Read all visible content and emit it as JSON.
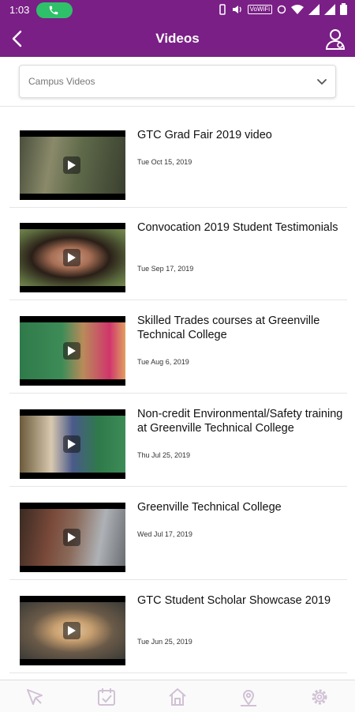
{
  "status": {
    "time": "1:03",
    "vowifi": "VoWiFi"
  },
  "header": {
    "title": "Videos"
  },
  "filter": {
    "selected": "Campus Videos"
  },
  "videos": [
    {
      "title": "GTC Grad Fair 2019 video",
      "date": "Tue Oct 15, 2019"
    },
    {
      "title": "Convocation 2019 Student Testimonials",
      "date": "Tue Sep 17, 2019"
    },
    {
      "title": "Skilled Trades courses at Greenville Technical College",
      "date": "Tue Aug 6, 2019"
    },
    {
      "title": "Non-credit Environmental/Safety training at Greenville Technical College",
      "date": "Thu Jul 25, 2019"
    },
    {
      "title": "Greenville Technical College",
      "date": "Wed Jul 17, 2019"
    },
    {
      "title": "GTC Student Scholar Showcase 2019",
      "date": "Tue Jun 25, 2019"
    }
  ],
  "bottom_nav": [
    "cursor-icon",
    "calendar-check-icon",
    "home-icon",
    "map-pin-icon",
    "gear-icon"
  ],
  "colors": {
    "brand": "#7a1f86",
    "call": "#2fc06a",
    "nav_icon": "#d1c1d5"
  }
}
